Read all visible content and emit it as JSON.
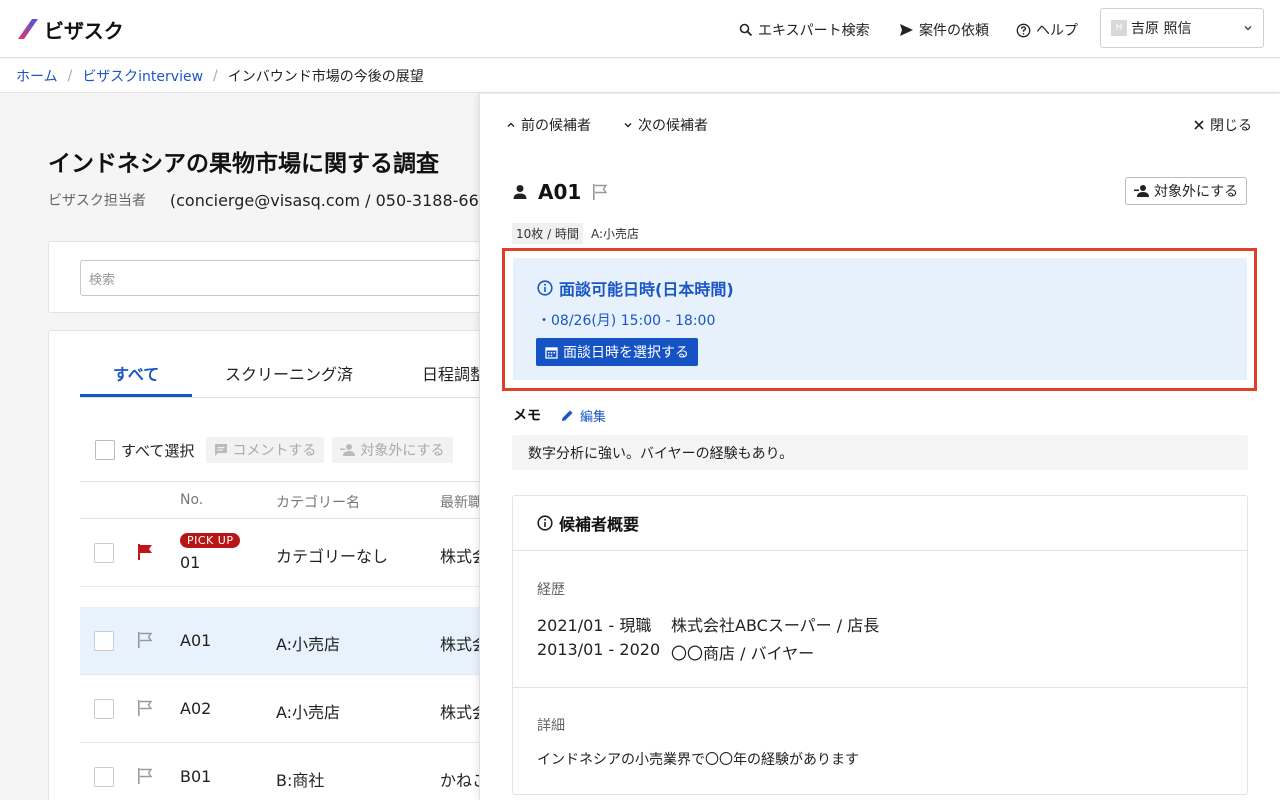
{
  "colors": {
    "accent": "#1a56c4",
    "highlight_border": "#e0402a",
    "pickup_badge": "#b81616",
    "info_bg": "#e7f1fc",
    "selected_row_bg": "#e8f2fc"
  },
  "header": {
    "logo_text": "ビザスク",
    "nav": {
      "expert_search": "エキスパート検索",
      "request": "案件の依頼",
      "help": "ヘルプ"
    },
    "user": {
      "avatar_initials": "H",
      "name": "吉原 照信"
    }
  },
  "breadcrumb": {
    "home": "ホーム",
    "interview": "ビザスクinterview",
    "current": "インバウンド市場の今後の展望"
  },
  "project": {
    "title": "インドネシアの果物市場に関する調査",
    "owner_label": "ビザスク担当者",
    "owner_contact": "(concierge@visasq.com / 050-3188-66"
  },
  "search": {
    "placeholder": "検索"
  },
  "tabs": [
    {
      "label": "すべて"
    },
    {
      "label": "スクリーニング済"
    },
    {
      "label": "日程調整"
    }
  ],
  "bulk": {
    "select_all": "すべて選択",
    "comment": "コメントする",
    "exclude": "対象外にする"
  },
  "table": {
    "headers": {
      "no": "No.",
      "category": "カテゴリー名",
      "latest": "最新職"
    },
    "rows": [
      {
        "badge": "PICK UP",
        "no": "01",
        "category": "カテゴリーなし",
        "company": "株式会",
        "flagged": true
      },
      {
        "no": "A01",
        "category": "A:小売店",
        "company": "株式会",
        "flagged": false,
        "selected": true
      },
      {
        "no": "A02",
        "category": "A:小売店",
        "company": "株式会",
        "flagged": false
      },
      {
        "no": "B01",
        "category": "B:商社",
        "company": "かねこ",
        "flagged": false
      }
    ]
  },
  "panel": {
    "prev": "前の候補者",
    "next": "次の候補者",
    "close": "閉じる",
    "candidate_id": "A01",
    "exclude_button": "対象外にする",
    "rate_badge": "10枚 / 時間",
    "category": "A:小売店",
    "availability": {
      "title": "面談可能日時(日本時間)",
      "slot": "・08/26(月) 15:00 - 18:00",
      "select_button": "面談日時を選択する"
    },
    "memo": {
      "label": "メモ",
      "edit": "編集",
      "text": "数字分析に強い。バイヤーの経験もあり。"
    },
    "overview": {
      "title": "候補者概要",
      "career_label": "経歴",
      "career": [
        {
          "period": "2021/01 - 現職",
          "desc": "株式会社ABCスーパー / 店長"
        },
        {
          "period": "2013/01 - 2020",
          "desc": "〇〇商店 / バイヤー"
        }
      ],
      "detail_label": "詳細",
      "detail_text": "インドネシアの小売業界で〇〇年の経験があります"
    }
  }
}
